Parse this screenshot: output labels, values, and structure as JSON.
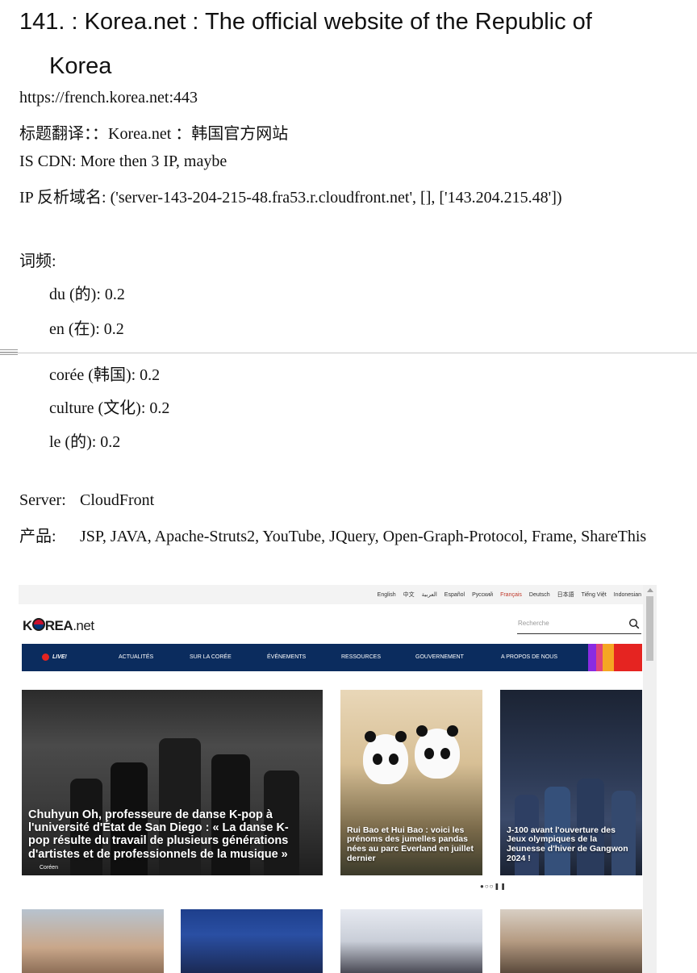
{
  "doc": {
    "title_line1": "141. : Korea.net : The official website of the Republic of",
    "title_line2": "Korea",
    "url": "https://french.korea.net:443",
    "translated_title": "标题翻译：：Korea.net ：韩国官方网站",
    "cdn": "IS CDN: More then 3 IP, maybe",
    "reverse_dns": "IP 反析域名: ('server-143-204-215-48.fra53.r.cloudfront.net', [], ['143.204.215.48'])",
    "word_freq_label": "词频:",
    "word_freq": [
      "du (的): 0.2",
      "en (在): 0.2",
      "corée (韩国): 0.2",
      "culture (文化): 0.2",
      "le (的): 0.2"
    ],
    "server_label": "Server:",
    "server_value": "CloudFront",
    "product_label": "产品:",
    "product_value": "JSP, JAVA, Apache-Struts2, YouTube, JQuery, Open-Graph-Protocol, Frame, ShareThis"
  },
  "site": {
    "languages": [
      "English",
      "中文",
      "العربية",
      "Español",
      "Русский",
      "Français",
      "Deutsch",
      "日本語",
      "Tiếng Việt",
      "Indonesian"
    ],
    "active_language": "Français",
    "logo_k": "K",
    "logo_rest": "REA",
    "logo_suffix": ".net",
    "search_placeholder": "Recherche",
    "nav": {
      "live": "LIVE!",
      "items": [
        "ACTUALITÉS",
        "SUR LA CORÉE",
        "ÉVÉNEMENTS",
        "RESSOURCES",
        "GOUVERNEMENT",
        "A PROPOS DE NOUS"
      ]
    },
    "stripe_colors": [
      "#8a2be2",
      "#e0457b",
      "#f5a623",
      "#e52421"
    ],
    "cards": [
      {
        "caption": "Chuhyun Oh, professeure de danse K-pop à l'université d'État de San Diego : « La danse K-pop résulte du travail de plusieurs générations d'artistes et de professionnels de la musique »",
        "tag": "Coréen"
      },
      {
        "caption": "Rui Bao et Hui Bao : voici les prénoms des jumelles pandas nées au parc Everland en juillet dernier"
      },
      {
        "caption": "J-100 avant l'ouverture des Jeux olympiques de la Jeunesse d'hiver de Gangwon 2024 !"
      }
    ],
    "carousel_dots": "●○○❚❚"
  }
}
